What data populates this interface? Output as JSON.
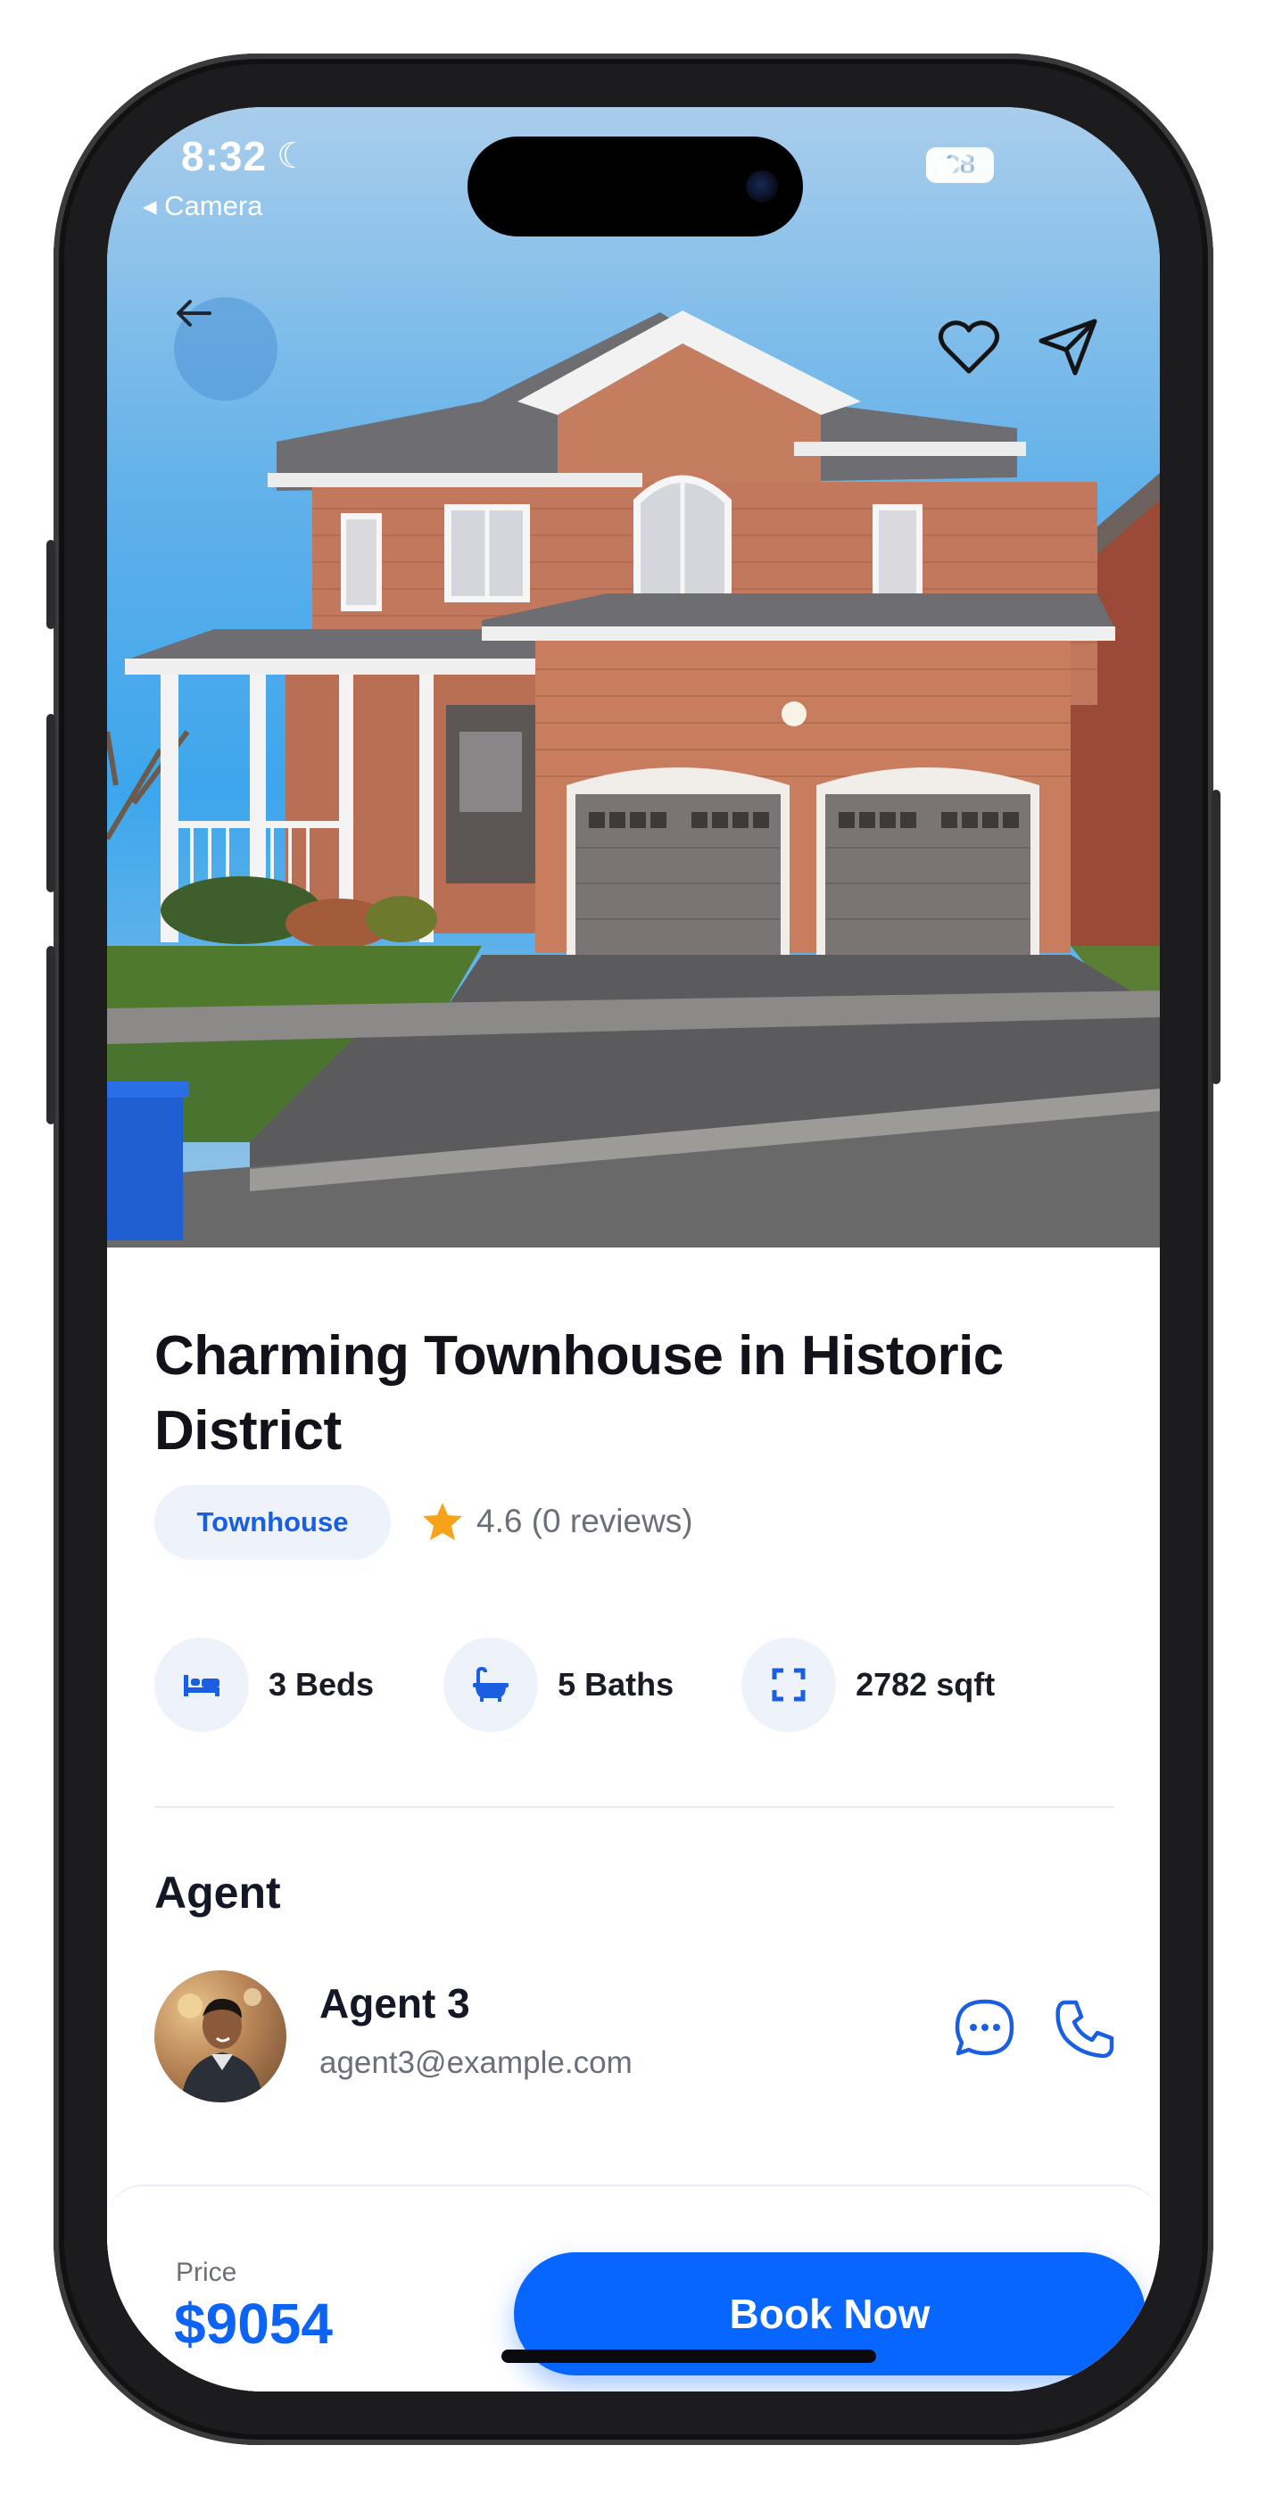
{
  "status_bar": {
    "time": "8:32",
    "back_label": "◂ Camera",
    "battery": "38"
  },
  "listing": {
    "title": "Charming Townhouse in Historic District",
    "type": "Townhouse",
    "rating_text": "4.6 (0 reviews)",
    "features": [
      {
        "icon": "bed-icon",
        "label": "3 Beds"
      },
      {
        "icon": "bath-icon",
        "label": "5 Baths"
      },
      {
        "icon": "expand-icon",
        "label": "2782 sqft"
      }
    ]
  },
  "agent": {
    "section_title": "Agent",
    "name": "Agent 3",
    "email": "agent3@example.com"
  },
  "booking": {
    "price_label": "Price",
    "price": "$9054",
    "button_label": "Book Now"
  },
  "colors": {
    "accent": "#0766ff",
    "price": "#0d63f3",
    "tag_text": "#1a5fe0",
    "star": "#f7a21b"
  }
}
